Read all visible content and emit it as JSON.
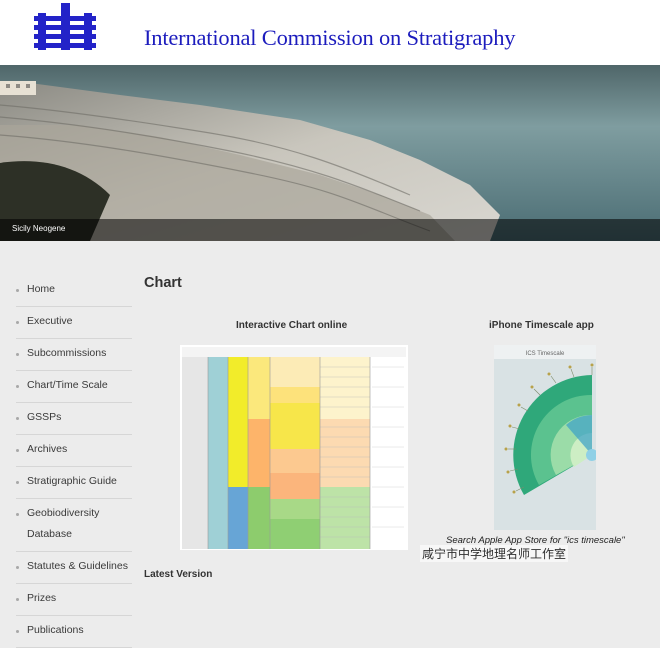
{
  "site": {
    "title": "International Commission on Stratigraphy"
  },
  "banner": {
    "caption": "Sicily Neogene"
  },
  "sidebar": {
    "items": [
      {
        "label": "Home"
      },
      {
        "label": "Executive"
      },
      {
        "label": "Subcommissions"
      },
      {
        "label": "Chart/Time Scale"
      },
      {
        "label": "GSSPs"
      },
      {
        "label": "Archives"
      },
      {
        "label": "Stratigraphic Guide"
      },
      {
        "label": "Geobiodiversity Database"
      },
      {
        "label": "Statutes & Guidelines"
      },
      {
        "label": "Prizes"
      },
      {
        "label": "Publications"
      }
    ]
  },
  "main": {
    "title": "Chart",
    "interactive_heading": "Interactive Chart online",
    "iphone_heading": "iPhone Timescale app",
    "app_store_note": "Search Apple App Store for \"ics timescale\"",
    "latest_heading": "Latest Version",
    "app_title": "ICS Timescale"
  },
  "watermark": "咸宁市中学地理名师工作室",
  "colors": {
    "title_blue": "#1c1cbd",
    "logo_blue": "#2323c8",
    "page_bg": "#ececec"
  }
}
